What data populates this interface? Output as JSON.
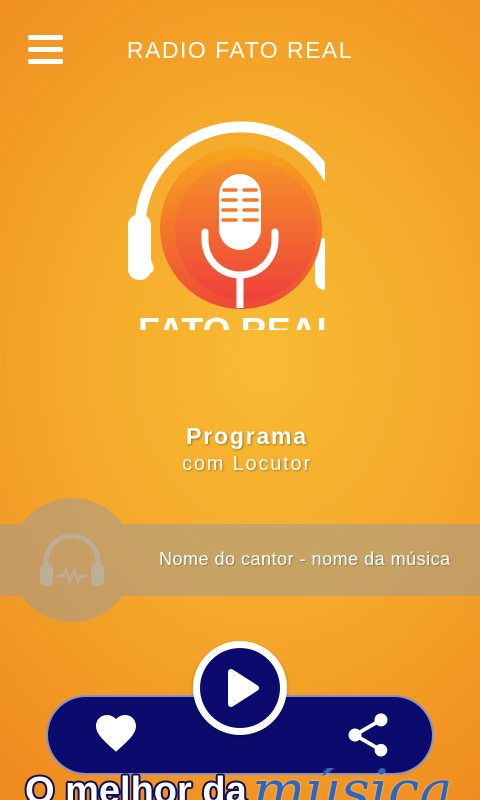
{
  "app": {
    "title": "RADIO FATO REAL"
  },
  "header": {
    "menu_icon": "hamburger-menu-icon"
  },
  "logo": {
    "text": "FATO REAL",
    "icon": "microphone-icon",
    "frame_icon": "headphones-icon"
  },
  "program": {
    "name": "Programa",
    "host": "com Locutor"
  },
  "now_playing": {
    "track": "Nome do cantor - nome da música",
    "cover_icon": "headphones-icon"
  },
  "controls": {
    "play_icon": "play-icon",
    "like_icon": "heart-icon",
    "share_icon": "share-icon"
  },
  "banner": {
    "line_1": "O melhor da",
    "line_2": "música"
  },
  "colors": {
    "background_center": "#f8bb34",
    "background": "#f5a92a",
    "background_edge": "#ef8c1f",
    "controls_bar": "#0b0b6e",
    "logo_disc_top": "#f8a51c",
    "logo_disc_bottom": "#ee4a36",
    "banner_script": "#2b66c0",
    "banner_outline": "#0e0e5e",
    "now_playing_overlay": "rgba(160,155,150,0.55)"
  }
}
